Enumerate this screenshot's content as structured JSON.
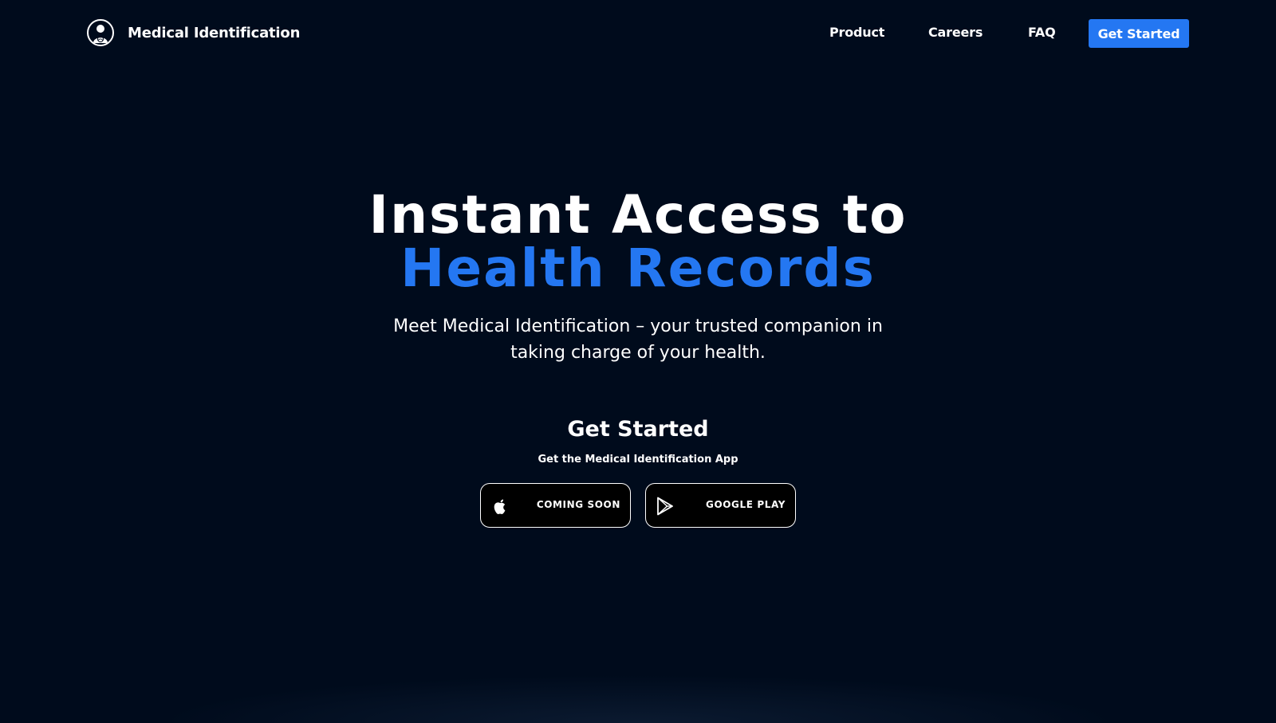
{
  "brand": {
    "name": "Medical Identification",
    "logo_icon": "person-avatar-icon"
  },
  "nav": {
    "links": [
      "Product",
      "Careers",
      "FAQ"
    ],
    "cta_label": "Get Started"
  },
  "hero": {
    "title_line1": "Instant Access to",
    "title_line2": "Health Records",
    "subtitle": "Meet Medical Identification – your trusted companion in taking charge of your health."
  },
  "get_started": {
    "heading": "Get Started",
    "subheading": "Get the Medical Identification App",
    "buttons": [
      {
        "label": "COMING SOON",
        "icon": "apple-icon"
      },
      {
        "label": "GOOGLE PLAY",
        "icon": "google-play-icon"
      }
    ]
  },
  "colors": {
    "background": "#000b1c",
    "accent": "#2477f2",
    "text": "#ffffff"
  }
}
